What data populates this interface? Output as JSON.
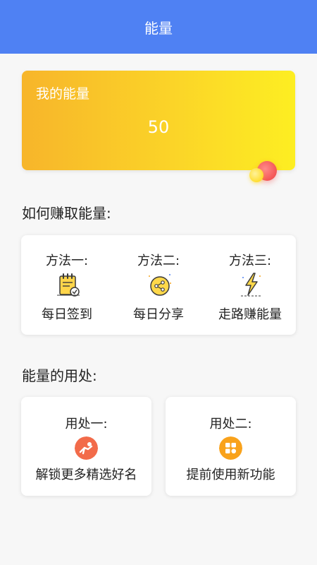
{
  "header": {
    "title": "能量"
  },
  "energy": {
    "label": "我的能量",
    "value": "50"
  },
  "earn": {
    "title": "如何赚取能量:",
    "methods": [
      {
        "title": "方法一:",
        "name": "每日签到",
        "icon": "calendar-check-icon"
      },
      {
        "title": "方法二:",
        "name": "每日分享",
        "icon": "share-icon"
      },
      {
        "title": "方法三:",
        "name": "走路赚能量",
        "icon": "lightning-icon"
      }
    ]
  },
  "uses": {
    "title": "能量的用处:",
    "items": [
      {
        "title": "用处一:",
        "name": "解锁更多精选好名",
        "icon": "running-person-icon",
        "color": "#f26b4a"
      },
      {
        "title": "用处二:",
        "name": "提前使用新功能",
        "icon": "app-grid-icon",
        "color": "#f9a21b"
      }
    ]
  },
  "colors": {
    "header": "#4f81f3",
    "energy_card_start": "#f7b52a",
    "energy_card_end": "#fdee22"
  }
}
